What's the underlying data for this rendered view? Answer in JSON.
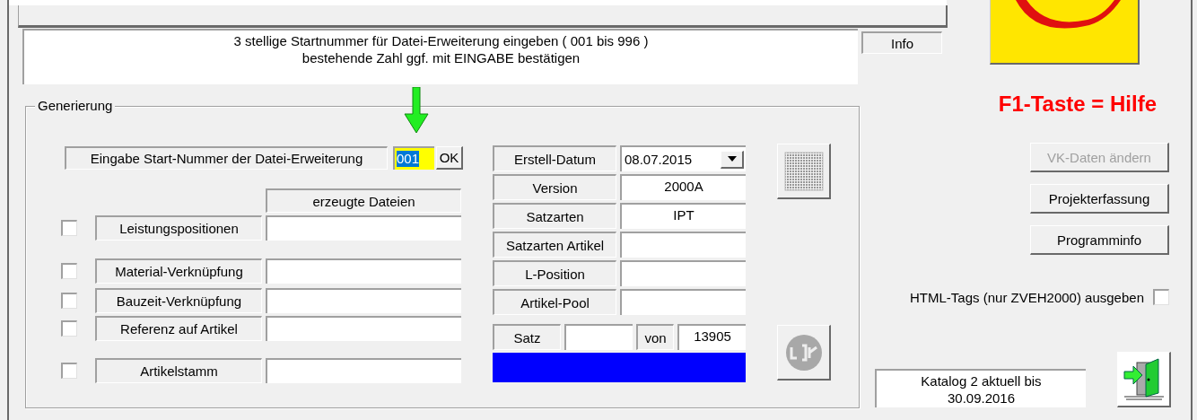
{
  "message": {
    "lines": [
      "3 stellige Startnummer für Datei-Erweiterung eingeben ( 001 bis 996 )",
      "bestehende Zahl ggf. mit EINGABE bestätigen"
    ]
  },
  "info_label": "Info",
  "group": {
    "title": "Generierung",
    "start": {
      "label": "Eingabe Start-Nummer der Datei-Erweiterung",
      "value": "001",
      "button": "OK"
    },
    "files_header": "erzeugte Dateien",
    "outputs": [
      {
        "label": "Leistungspositionen",
        "checked": false
      },
      {
        "label": "Material-Verknüpfung",
        "checked": false
      },
      {
        "label": "Bauzeit-Verknüpfung",
        "checked": false
      },
      {
        "label": "Referenz auf Artikel",
        "checked": false
      },
      {
        "label": "Artikelstamm",
        "checked": false
      }
    ],
    "details": [
      {
        "label": "Erstell-Datum",
        "value": "08.07.2015",
        "kind": "dropdown"
      },
      {
        "label": "Version",
        "value": "2000A",
        "kind": "field"
      },
      {
        "label": "Satzarten",
        "value": "IPT",
        "kind": "field"
      },
      {
        "label": "Satzarten Artikel",
        "kind": "field"
      },
      {
        "label": "L-Position",
        "kind": "field"
      },
      {
        "label": "Artikel-Pool",
        "kind": "field"
      }
    ],
    "record": {
      "label": "Satz",
      "of_label": "von",
      "total": "13905"
    },
    "progress": {
      "level": 1
    }
  },
  "help_text": "F1-Taste = Hilfe",
  "buttons": [
    {
      "label": "VK-Daten ändern",
      "disabled": true
    },
    {
      "label": "Projekterfassung",
      "disabled": false
    },
    {
      "label": "Programminfo",
      "disabled": false
    }
  ],
  "html_tags": {
    "label": "HTML-Tags (nur ZVEH2000) ausgeben",
    "checked": false
  },
  "catalog": {
    "lines": [
      "Katalog 2 aktuell bis",
      "30.09.2016"
    ]
  }
}
